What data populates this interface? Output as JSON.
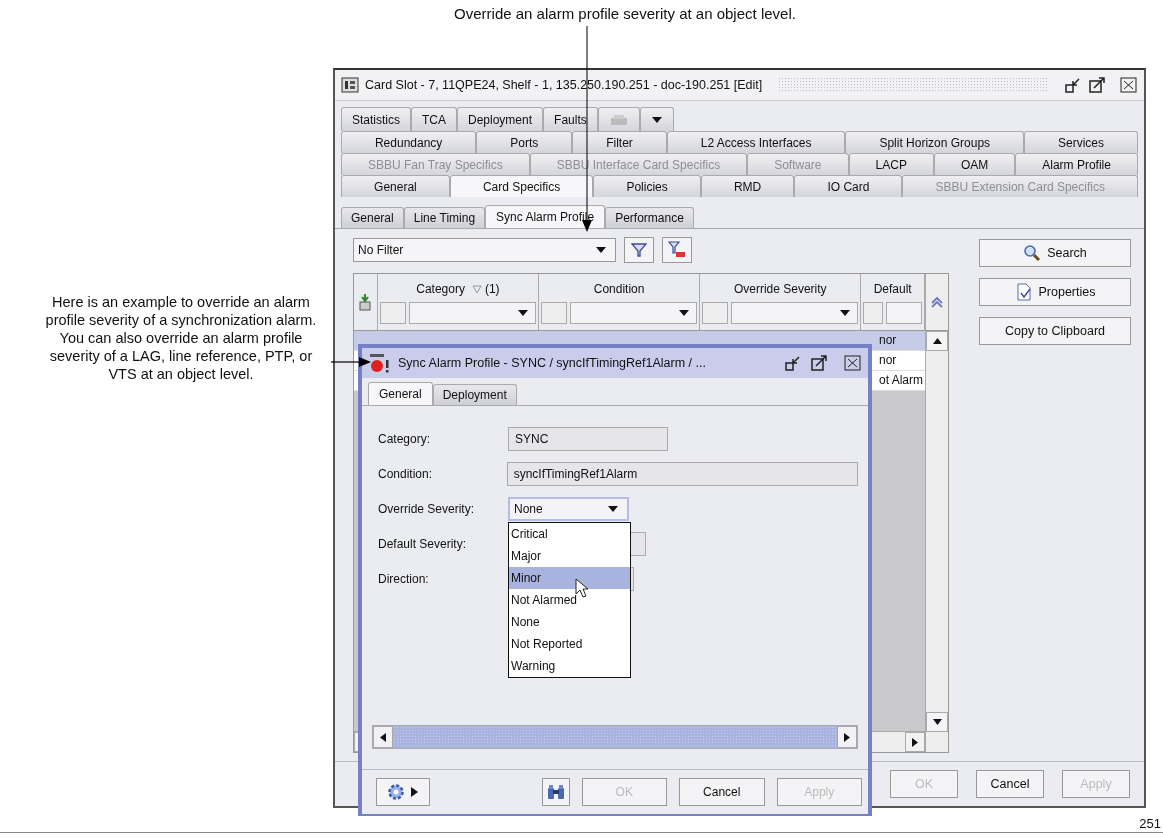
{
  "callouts": [
    {
      "text": "Override an alarm profile severity at an object level."
    },
    {
      "text": "Here is an example to override an alarm profile severity of a synchronization alarm. You can also override an alarm profile severity of a LAG, line reference, PTP, or VTS at an object level."
    }
  ],
  "window": {
    "title": "Card Slot - 7, 11QPE24, Shelf - 1, 135.250.190.251 - doc-190.251 [Edit]",
    "tab_rows": [
      [
        {
          "label": "Statistics",
          "selected": false,
          "disabled": false
        },
        {
          "label": "TCA",
          "selected": false,
          "disabled": false
        },
        {
          "label": "Deployment",
          "selected": false,
          "disabled": false
        },
        {
          "label": "Faults",
          "selected": false,
          "disabled": false
        }
      ],
      [
        {
          "label": "Redundancy",
          "selected": false,
          "disabled": false
        },
        {
          "label": "Ports",
          "selected": false,
          "disabled": false
        },
        {
          "label": "Filter",
          "selected": false,
          "disabled": false
        },
        {
          "label": "L2 Access Interfaces",
          "selected": false,
          "disabled": false
        },
        {
          "label": "Split Horizon Groups",
          "selected": false,
          "disabled": false
        },
        {
          "label": "Services",
          "selected": false,
          "disabled": false
        }
      ],
      [
        {
          "label": "SBBU Fan Tray Specifics",
          "selected": false,
          "disabled": true
        },
        {
          "label": "SBBU Interface Card Specifics",
          "selected": false,
          "disabled": true
        },
        {
          "label": "Software",
          "selected": false,
          "disabled": true
        },
        {
          "label": "LACP",
          "selected": false,
          "disabled": false
        },
        {
          "label": "OAM",
          "selected": false,
          "disabled": false
        },
        {
          "label": "Alarm Profile",
          "selected": false,
          "disabled": false
        }
      ],
      [
        {
          "label": "General",
          "selected": false,
          "disabled": false
        },
        {
          "label": "Card Specifics",
          "selected": true,
          "disabled": false
        },
        {
          "label": "Policies",
          "selected": false,
          "disabled": false
        },
        {
          "label": "RMD",
          "selected": false,
          "disabled": false
        },
        {
          "label": "IO Card",
          "selected": false,
          "disabled": false
        },
        {
          "label": "SBBU Extension Card Specifics",
          "selected": false,
          "disabled": true
        }
      ]
    ],
    "subtabs": [
      {
        "label": "General",
        "selected": false
      },
      {
        "label": "Line Timing",
        "selected": false
      },
      {
        "label": "Sync Alarm Profile",
        "selected": true
      },
      {
        "label": "Performance",
        "selected": false
      }
    ],
    "filter": {
      "value": "No Filter"
    },
    "table": {
      "columns": [
        {
          "label": "Category",
          "sort_count": "(1)"
        },
        {
          "label": "Condition"
        },
        {
          "label": "Override Severity"
        },
        {
          "label": "Default"
        }
      ],
      "rows": [
        {
          "default_severity": "nor",
          "selected": true
        },
        {
          "default_severity": "nor",
          "selected": false
        },
        {
          "default_severity": "ot Alarm",
          "selected": false
        }
      ]
    },
    "side_buttons": [
      {
        "label": "Search",
        "kind": "search"
      },
      {
        "label": "Properties",
        "kind": "properties"
      },
      {
        "label": "Copy to Clipboard",
        "kind": "plain"
      }
    ],
    "footer_buttons": [
      {
        "label": "OK",
        "disabled": true
      },
      {
        "label": "Cancel",
        "disabled": false
      },
      {
        "label": "Apply",
        "disabled": true
      }
    ]
  },
  "dialog": {
    "title": "Sync Alarm Profile - SYNC / syncIfTimingRef1Alarm / ...",
    "tabs": [
      {
        "label": "General",
        "selected": true
      },
      {
        "label": "Deployment",
        "selected": false
      }
    ],
    "fields": [
      {
        "label": "Category:",
        "kind": "text",
        "value": "SYNC"
      },
      {
        "label": "Condition:",
        "kind": "text",
        "value": "syncIfTimingRef1Alarm"
      },
      {
        "label": "Override Severity:",
        "kind": "combo",
        "value": "None"
      },
      {
        "label": "Default Severity:",
        "kind": "text"
      },
      {
        "label": "Direction:",
        "kind": "text"
      }
    ],
    "options": [
      {
        "label": "Critical",
        "selected": false
      },
      {
        "label": "Major",
        "selected": false
      },
      {
        "label": "Minor",
        "selected": true
      },
      {
        "label": "Not Alarmed",
        "selected": false
      },
      {
        "label": "None",
        "selected": false
      },
      {
        "label": "Not Reported",
        "selected": false
      },
      {
        "label": "Warning",
        "selected": false
      }
    ],
    "footer_buttons": [
      {
        "label": "OK",
        "disabled": true
      },
      {
        "label": "Cancel",
        "disabled": false
      },
      {
        "label": "Apply",
        "disabled": true
      }
    ]
  },
  "figure_number": "251"
}
